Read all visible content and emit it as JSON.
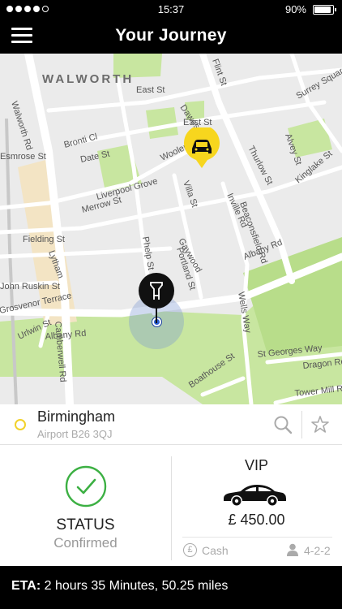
{
  "status_bar": {
    "signal_strength": "4 of 5",
    "time": "15:37",
    "battery_percent": "90%",
    "battery_level": 0.9
  },
  "nav": {
    "title": "Your Journey",
    "menu_icon": "hamburger-menu-icon"
  },
  "map": {
    "area_label": "WALWORTH",
    "streets": [
      "Walworth Rd",
      "East St",
      "Flint St",
      "Dawes St",
      "East St",
      "Bronti Cl",
      "Merrow St",
      "Date St",
      "Liverpool Grove",
      "Woolers",
      "Villa St",
      "Thurlow St",
      "Surrey Square",
      "Alvey St",
      "Kinglake St",
      "Fielding St",
      "Inville Rd",
      "Beaconsfield Rd",
      "Gaywood",
      "Phelp St",
      "Portland St",
      "Albany Rd",
      "Albany Rd",
      "John Ruskin St",
      "Grosvenor Terrace",
      "Urlwin St",
      "Camberwell Rd",
      "Wells Way",
      "St Georges Way",
      "Dragon Rd",
      "Tower Mill Rd",
      "Boathouse St",
      "Esmrose St",
      "Lytham"
    ],
    "park_color": "#c8e6a0",
    "taxi_marker_color": "#f7d61e",
    "user_marker_color": "#111111"
  },
  "destination": {
    "title": "Birmingham",
    "subtitle": "Airport B26 3QJ",
    "search_icon": "search-icon",
    "favorite_icon": "star-icon"
  },
  "booking": {
    "status_label": "STATUS",
    "status_value": "Confirmed",
    "vehicle_class": "VIP",
    "price": "£ 450.00",
    "payment_method": "Cash",
    "passengers": "4-2-2",
    "accent_color": "#3cb043"
  },
  "eta": {
    "label": "ETA:",
    "value": "2 hours 35 Minutes, 50.25 miles"
  }
}
